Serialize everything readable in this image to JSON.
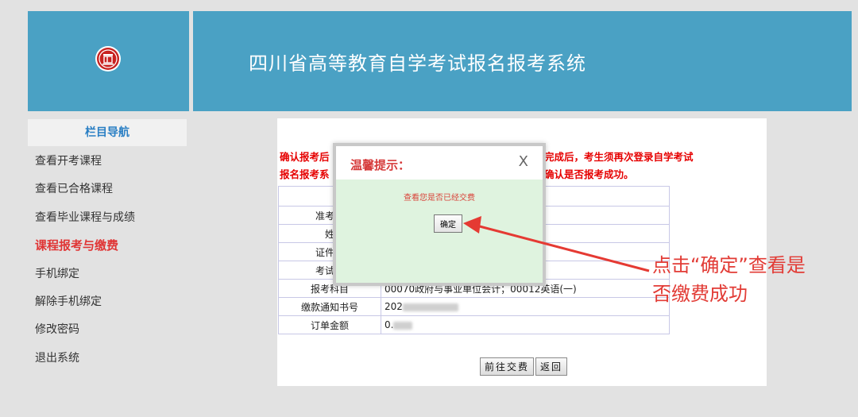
{
  "header": {
    "logo_name": "emblem-logo",
    "title": "四川省高等教育自学考试报名报考系统"
  },
  "sidebar": {
    "header": "栏目导航",
    "items": [
      {
        "label": "查看开考课程",
        "active": false
      },
      {
        "label": "查看已合格课程",
        "active": false
      },
      {
        "label": "查看毕业课程与成绩",
        "active": false
      },
      {
        "label": "课程报考与缴费",
        "active": true
      },
      {
        "label": "手机绑定",
        "active": false
      },
      {
        "label": "解除手机绑定",
        "active": false
      },
      {
        "label": "修改密码",
        "active": false
      },
      {
        "label": "退出系统",
        "active": false
      }
    ]
  },
  "main": {
    "notice_left_1": "确认报考后",
    "notice_left_2": "报名报考系",
    "notice_right_1": "完成后，考生须再次登录自学考试",
    "notice_right_2": "确认是否报考成功。",
    "rows": [
      {
        "key": "",
        "value": ""
      },
      {
        "key": "准考证",
        "value": ""
      },
      {
        "key": "姓",
        "value": ""
      },
      {
        "key": "证件号",
        "value": ""
      },
      {
        "key": "考试县",
        "value": ""
      },
      {
        "key": "报考科目",
        "value": "00070政府与事业单位会计；00012英语(一)"
      },
      {
        "key": "缴款通知书号",
        "value": "202"
      },
      {
        "key": "订单金额",
        "value": "0."
      }
    ],
    "pay_button": "前往交费",
    "back_button": "返回"
  },
  "modal": {
    "title": "温馨提示：",
    "close": "X",
    "message": "查看您是否已经交费",
    "ok_button": "确定"
  },
  "annotation": {
    "line1": "点击“确定”查看是",
    "line2": "否缴费成功",
    "color": "#e23b35"
  }
}
